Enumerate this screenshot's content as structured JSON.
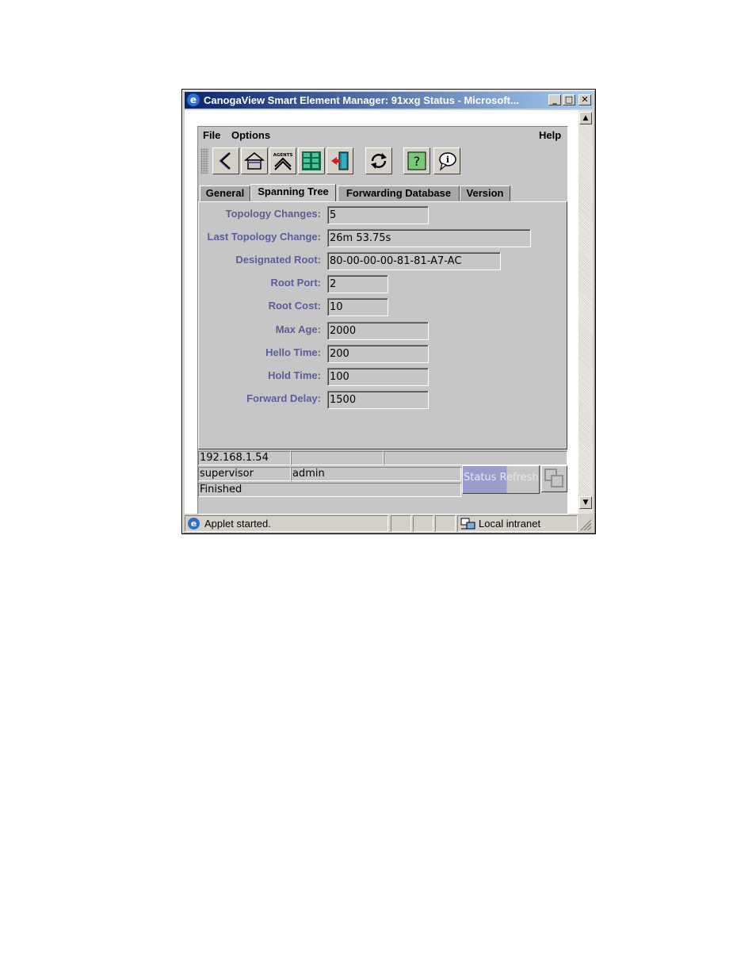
{
  "window": {
    "title": "CanogaView Smart Element Manager: 91xxg Status - Microsoft..."
  },
  "menubar": {
    "file": "File",
    "options": "Options",
    "help": "Help"
  },
  "toolbar": {
    "agents_label": "AGENTS",
    "icons": [
      "back-icon",
      "home-icon",
      "agents-icon",
      "grid-icon",
      "exit-door-icon",
      "refresh-icon",
      "help-icon",
      "info-balloon-icon"
    ]
  },
  "tabs": [
    {
      "label": "General",
      "active": false
    },
    {
      "label": "Spanning Tree",
      "active": true
    },
    {
      "label": "Forwarding Database",
      "active": false
    },
    {
      "label": "Version",
      "active": false
    }
  ],
  "fields": [
    {
      "label": "Topology Changes:",
      "value": "5"
    },
    {
      "label": "Last Topology Change:",
      "value": "26m 53.75s"
    },
    {
      "label": "Designated Root:",
      "value": "80-00-00-00-81-81-A7-AC"
    },
    {
      "label": "Root Port:",
      "value": "2"
    },
    {
      "label": "Root Cost:",
      "value": "10"
    },
    {
      "label": "Max Age:",
      "value": "2000"
    },
    {
      "label": "Hello Time:",
      "value": "200"
    },
    {
      "label": "Hold Time:",
      "value": "100"
    },
    {
      "label": "Forward Delay:",
      "value": "1500"
    }
  ],
  "status": {
    "ip": "192.168.1.54",
    "cell2": "",
    "cell3": "",
    "role": "supervisor",
    "user": "admin",
    "message": "Finished",
    "refresh_label": "Status Refresh",
    "refresh_progress": 0.58
  },
  "ie_status": {
    "message": "Applet started.",
    "zone": "Local intranet"
  },
  "colors": {
    "title_start": "#0a246a",
    "title_end": "#a6caf0",
    "label_color": "#5c5c9c",
    "progress_fill": "#9c9ccc"
  }
}
